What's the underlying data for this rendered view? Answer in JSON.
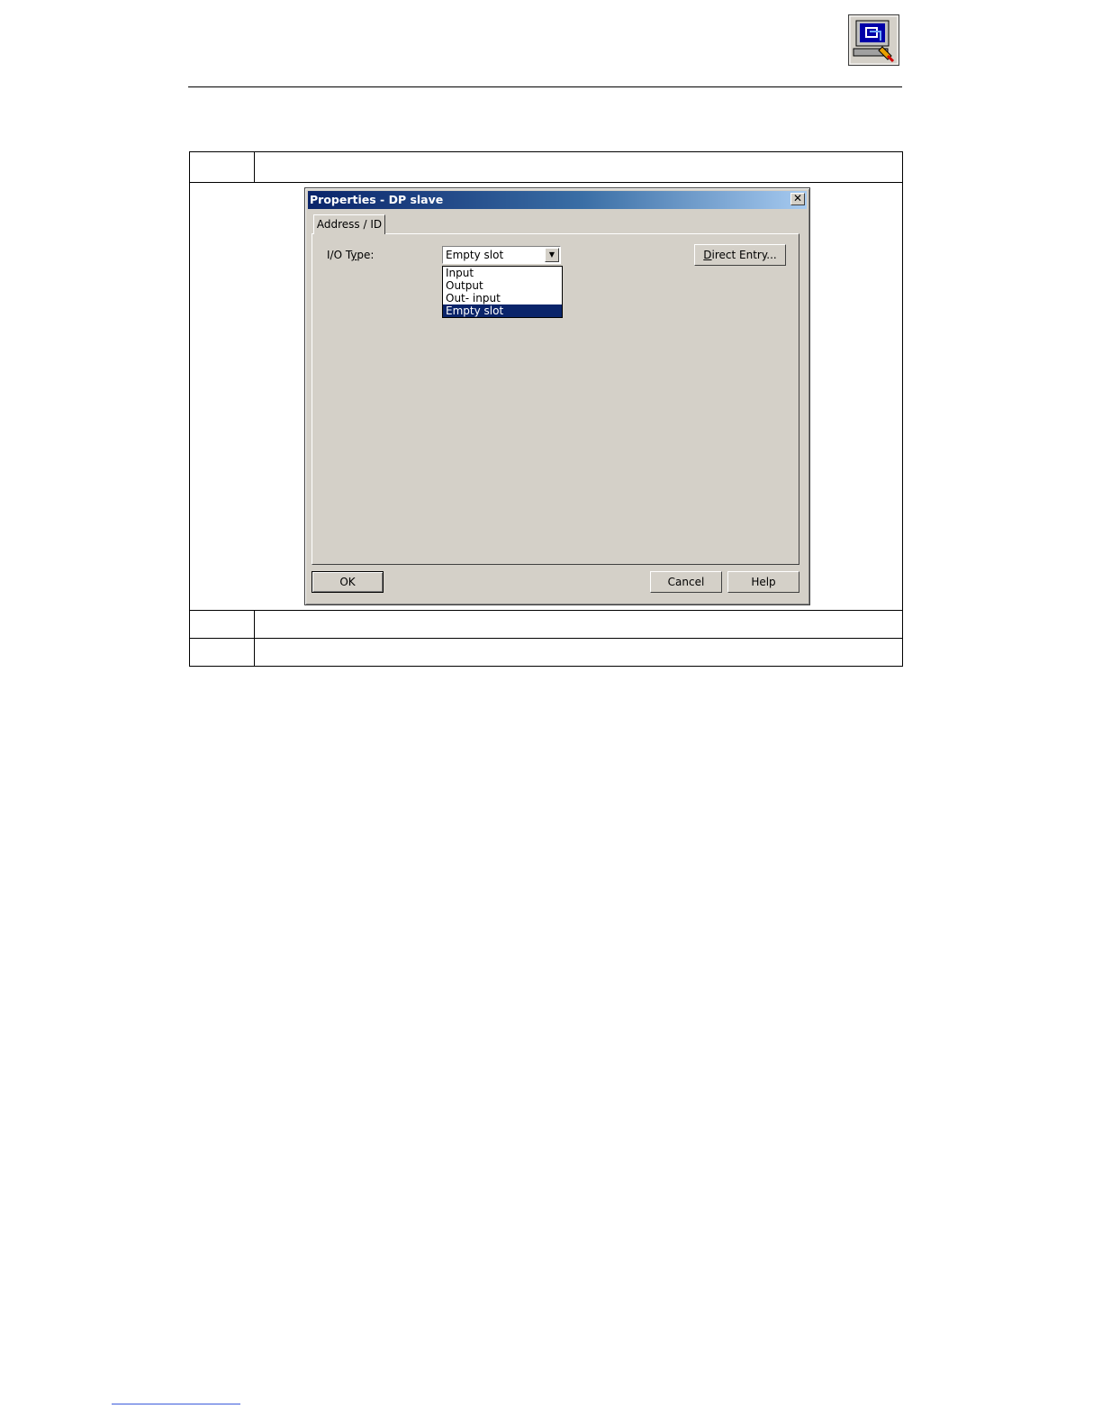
{
  "dialog": {
    "title": "Properties - DP slave",
    "close_symbol": "✕",
    "tab_label": "Address / ID",
    "io_type_label_pre": "I/O T",
    "io_type_label_ul": "y",
    "io_type_label_post": "pe:",
    "io_type_value": "Empty slot",
    "options": [
      "Input",
      "Output",
      "Out- input",
      "Empty slot"
    ],
    "selected_option": "Empty slot",
    "direct_entry_ul": "D",
    "direct_entry_rest": "irect Entry...",
    "ok_label": "OK",
    "cancel_label": "Cancel",
    "help_label": "Help"
  },
  "icons": {
    "header": "computer-monitor-icon",
    "dropdown_arrow": "chevron-down-icon"
  },
  "colors": {
    "titlebar_start": "#0a246a",
    "titlebar_end": "#a6caf0",
    "dialog_face": "#d4d0c8",
    "selection": "#0a246a",
    "footer_rule": "#3b5bdb"
  }
}
